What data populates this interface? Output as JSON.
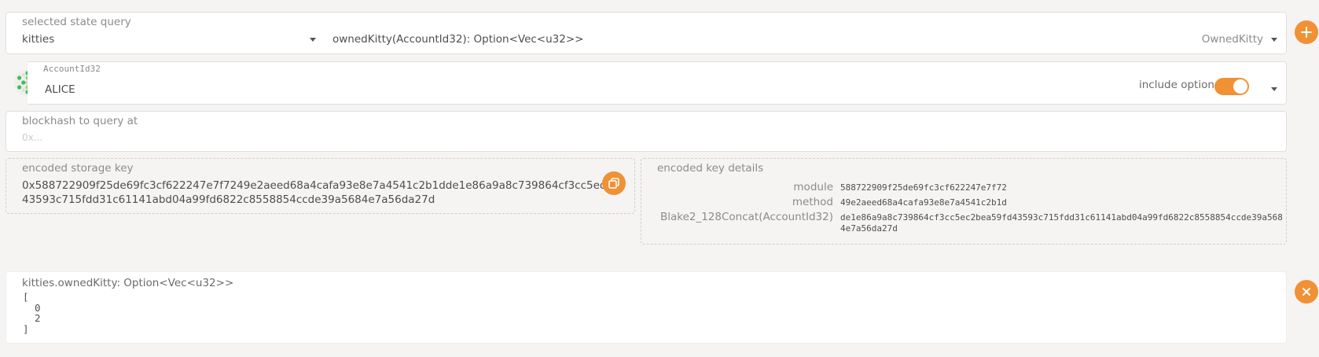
{
  "query": {
    "label": "selected state query",
    "module": "kitties",
    "method": "ownedKitty(AccountId32): Option<Vec<u32>>",
    "type_name": "OwnedKitty"
  },
  "account": {
    "label": "AccountId32",
    "value": "ALICE",
    "include_option_label": "include option",
    "include_option_on": true
  },
  "blockhash": {
    "label": "blockhash to query at",
    "placeholder": "0x..."
  },
  "storage_key": {
    "label": "encoded storage key",
    "line1": "0x588722909f25de69fc3cf622247e7f7249e2aeed68a4cafa93e8e7a4541c2b1dde1e86a9a8c739864cf3cc5ec2bea59fd",
    "line2": "43593c715fdd31c61141abd04a99fd6822c8558854ccde39a5684e7a56da27d"
  },
  "key_details": {
    "label": "encoded key details",
    "rows": [
      {
        "key": "module",
        "value": "588722909f25de69fc3cf622247e7f72"
      },
      {
        "key": "method",
        "value": "49e2aeed68a4cafa93e8e7a4541c2b1d"
      },
      {
        "key": "Blake2_128Concat(AccountId32)",
        "value": "de1e86a9a8c739864cf3cc5ec2bea59fd43593c715fdd31c61141abd04a99fd6822c8558854ccde39a568",
        "value2": "4e7a56da27d"
      }
    ]
  },
  "result": {
    "title": "kitties.ownedKitty: Option<Vec<u32>>",
    "lines": [
      "[",
      "  0",
      "  2",
      "]"
    ]
  },
  "colors": {
    "accent": "#f19135",
    "background": "#f5f4f3"
  },
  "icons": {
    "add": "plus-icon",
    "copy": "copy-icon",
    "close": "close-icon",
    "identicon": "identicon-icon"
  }
}
